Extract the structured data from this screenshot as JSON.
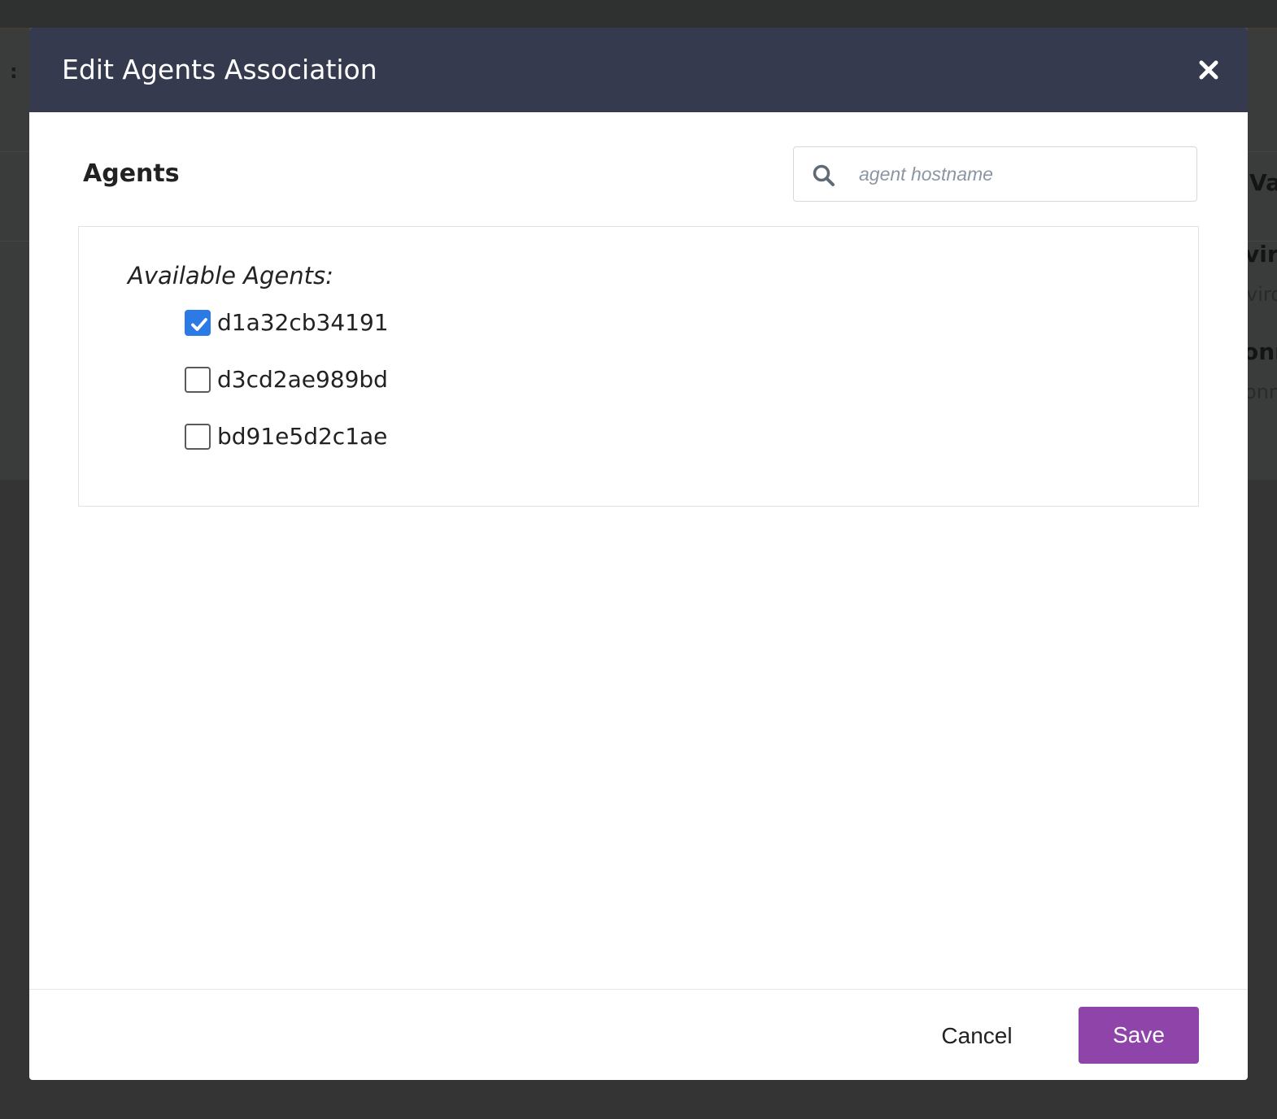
{
  "background": {
    "colon": ":",
    "fragments": [
      "Va",
      "viro",
      "viro",
      "onn",
      "onn"
    ]
  },
  "modal": {
    "title": "Edit Agents Association",
    "close_icon": "close-icon"
  },
  "body": {
    "section_title": "Agents",
    "search": {
      "placeholder": "agent hostname",
      "value": "",
      "icon": "search-icon"
    },
    "available_heading": "Available Agents:",
    "agents": [
      {
        "label": "d1a32cb34191",
        "checked": true
      },
      {
        "label": "d3cd2ae989bd",
        "checked": false
      },
      {
        "label": "bd91e5d2c1ae",
        "checked": false
      }
    ]
  },
  "footer": {
    "cancel_label": "Cancel",
    "save_label": "Save"
  },
  "colors": {
    "header_bg": "#363a4e",
    "checkbox_checked": "#2b7ae6",
    "save_button": "#8e44a8"
  }
}
